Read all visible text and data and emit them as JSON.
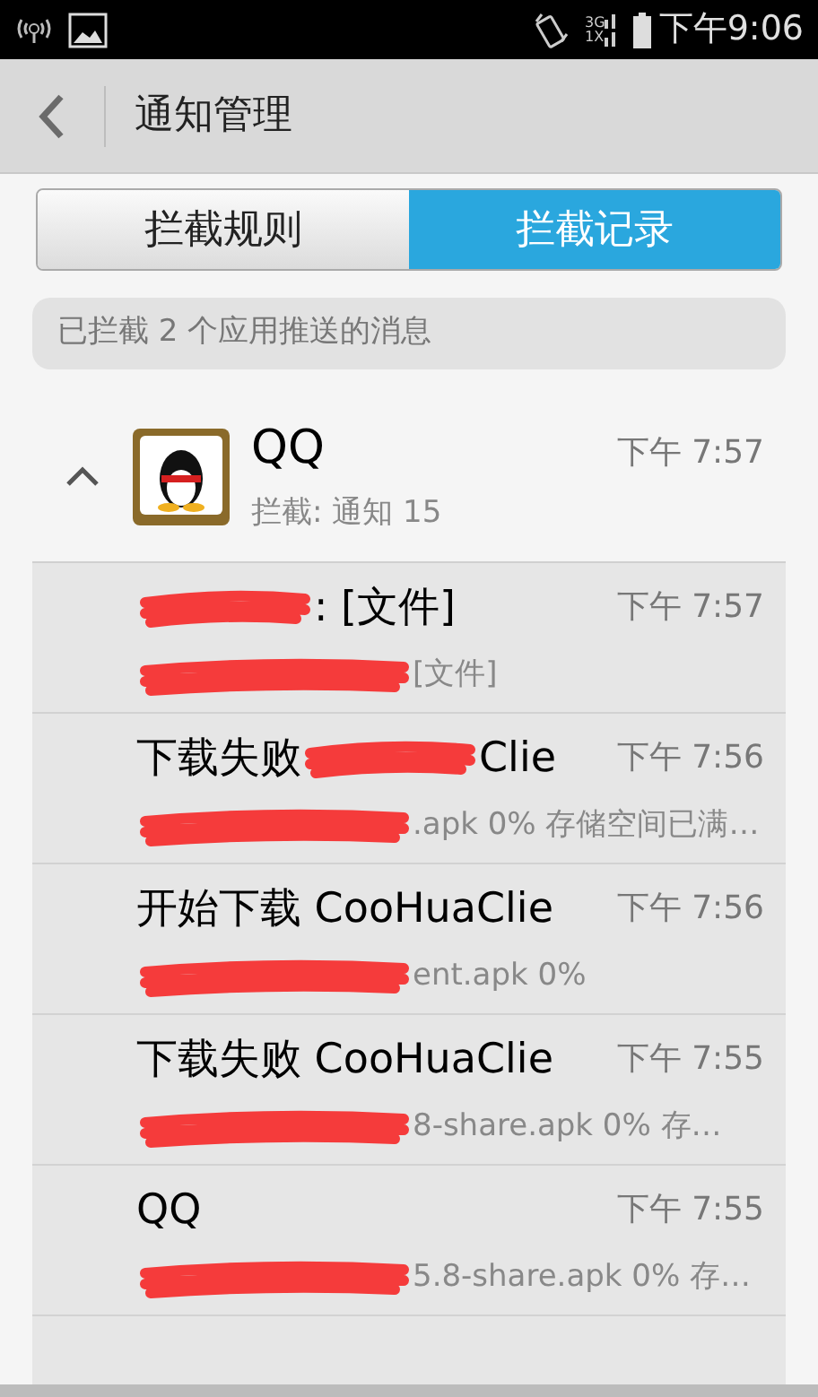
{
  "status_bar": {
    "network_top": "3G",
    "network_bottom": "1X",
    "time": "下午9:06"
  },
  "toolbar": {
    "title": "通知管理"
  },
  "tabs": [
    {
      "label": "拦截规则",
      "selected": false
    },
    {
      "label": "拦截记录",
      "selected": true
    }
  ],
  "summary": "已拦截 2 个应用推送的消息",
  "group": {
    "name": "QQ",
    "time": "下午 7:57",
    "detail": "拦截: 通知 15",
    "expanded": true,
    "rows": [
      {
        "title": [
          {
            "kind": "redaction"
          },
          {
            "kind": "text",
            "text": ": [文件]"
          }
        ],
        "subtitle": [
          {
            "kind": "redaction"
          },
          {
            "kind": "text",
            "text": "[文件]"
          }
        ],
        "time": "下午 7:57"
      },
      {
        "title": [
          {
            "kind": "text",
            "text": "下载失败"
          },
          {
            "kind": "redaction"
          },
          {
            "kind": "text",
            "text": "Clie"
          }
        ],
        "subtitle": [
          {
            "kind": "redaction"
          },
          {
            "kind": "text",
            "text": ".apk 0% 存储空间已满…"
          }
        ],
        "time": "下午 7:56"
      },
      {
        "title": [
          {
            "kind": "text",
            "text": "开始下载 CooHuaClie"
          }
        ],
        "subtitle": [
          {
            "kind": "redaction"
          },
          {
            "kind": "text",
            "text": "ent.apk 0%"
          }
        ],
        "time": "下午 7:56"
      },
      {
        "title": [
          {
            "kind": "text",
            "text": "下载失败 CooHuaClie"
          }
        ],
        "subtitle": [
          {
            "kind": "redaction"
          },
          {
            "kind": "text",
            "text": "8-share.apk 0% 存…"
          }
        ],
        "time": "下午 7:55"
      },
      {
        "title": [
          {
            "kind": "text",
            "text": "QQ"
          }
        ],
        "subtitle": [
          {
            "kind": "redaction"
          },
          {
            "kind": "text",
            "text": "5.8-share.apk 0% 存…"
          }
        ],
        "time": "下午 7:55"
      }
    ]
  }
}
